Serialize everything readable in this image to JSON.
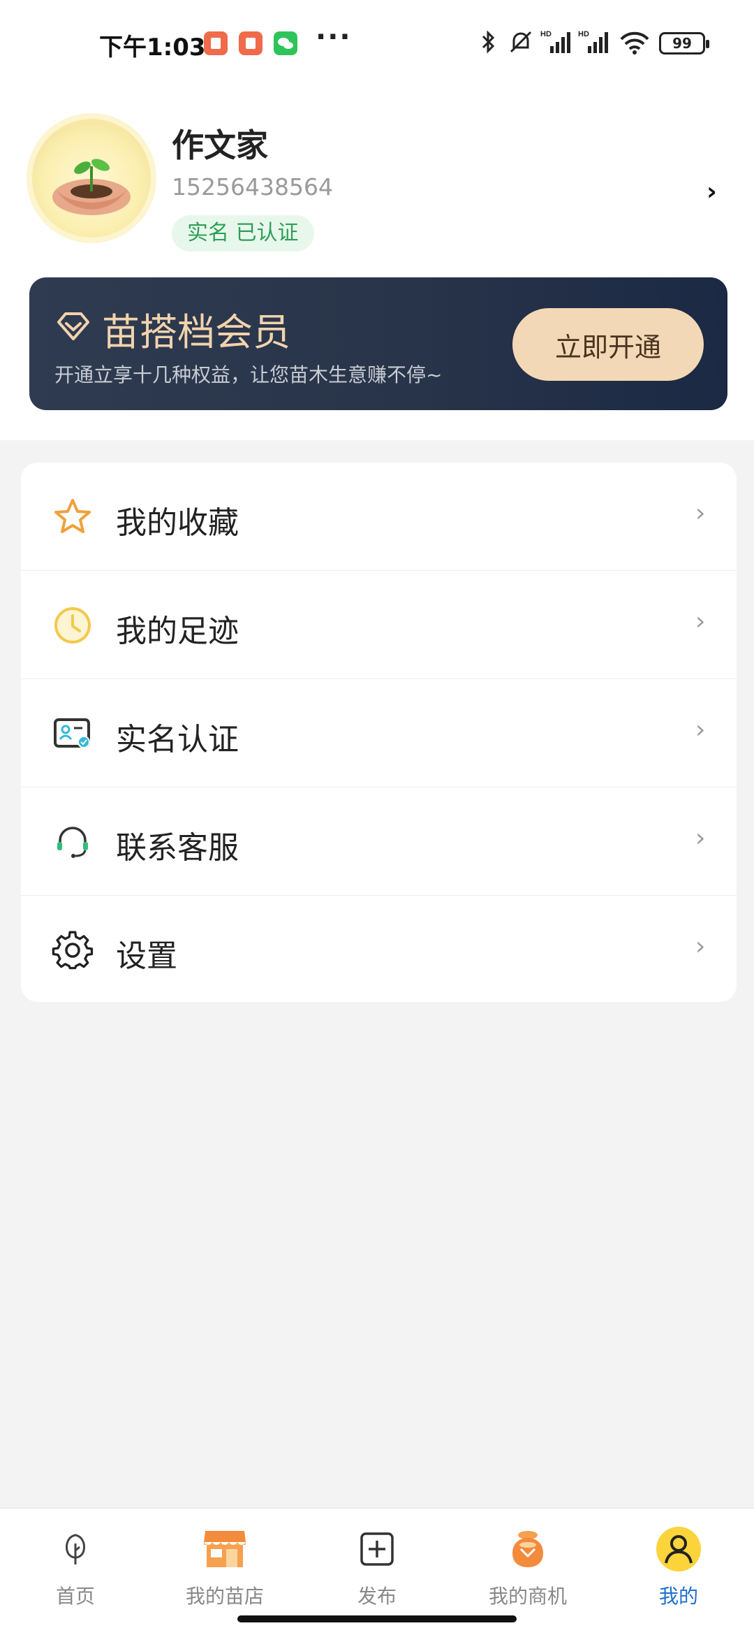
{
  "status_bar": {
    "time": "下午1:03",
    "battery": "99",
    "icons": [
      "app-notification-icon",
      "app-notification-icon",
      "wechat-icon",
      "more-icon",
      "bluetooth-icon",
      "mute-icon",
      "signal-hd-icon",
      "signal-hd-icon",
      "wifi-icon",
      "battery-icon"
    ]
  },
  "profile": {
    "name": "作文家",
    "phone": "15256438564",
    "verify_badge": "实名 已认证",
    "chevron": "›"
  },
  "vip": {
    "title": "苗搭档会员",
    "subtitle": "开通立享十几种权益，让您苗木生意赚不停~",
    "button": "立即开通",
    "colors": {
      "title": "#f2d3ad",
      "button_bg": "#f2d8b6"
    }
  },
  "menu": {
    "items": [
      {
        "label": "我的收藏",
        "icon": "star-icon"
      },
      {
        "label": "我的足迹",
        "icon": "clock-icon"
      },
      {
        "label": "实名认证",
        "icon": "id-card-icon"
      },
      {
        "label": "联系客服",
        "icon": "headset-icon"
      },
      {
        "label": "设置",
        "icon": "gear-icon"
      }
    ],
    "chevron": "›"
  },
  "tabbar": {
    "tabs": [
      {
        "label": "首页",
        "icon": "tree-icon"
      },
      {
        "label": "我的苗店",
        "icon": "store-icon"
      },
      {
        "label": "发布",
        "icon": "add-square-icon"
      },
      {
        "label": "我的商机",
        "icon": "money-bag-icon"
      },
      {
        "label": "我的",
        "icon": "user-icon",
        "active": true
      }
    ],
    "active_color": "#1f6fd0"
  }
}
